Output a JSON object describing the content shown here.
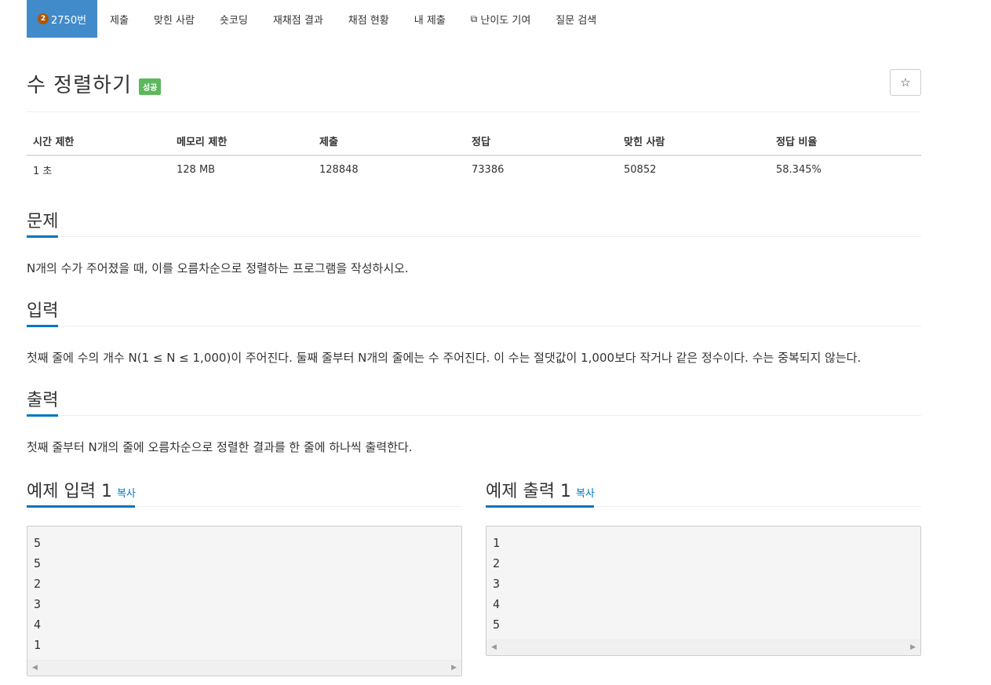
{
  "nav": {
    "problem_tier": "2",
    "problem_number": "2750번",
    "items": [
      "제출",
      "맞힌 사람",
      "숏코딩",
      "재채점 결과",
      "채점 현황",
      "내 제출"
    ],
    "difficulty": "난이도 기여",
    "qna": "질문 검색"
  },
  "title": {
    "text": "수 정렬하기",
    "badge": "성공",
    "star": "☆"
  },
  "info": {
    "headers": [
      "시간 제한",
      "메모리 제한",
      "제출",
      "정답",
      "맞힌 사람",
      "정답 비율"
    ],
    "values": [
      "1 초",
      "128 MB",
      "128848",
      "73386",
      "50852",
      "58.345%"
    ]
  },
  "problem": {
    "heading": "문제",
    "text": "N개의 수가 주어졌을 때, 이를 오름차순으로 정렬하는 프로그램을 작성하시오."
  },
  "input": {
    "heading": "입력",
    "text": "첫째 줄에 수의 개수 N(1 ≤ N ≤ 1,000)이 주어진다. 둘째 줄부터 N개의 줄에는 수 주어진다. 이 수는 절댓값이 1,000보다 작거나 같은 정수이다. 수는 중복되지 않는다."
  },
  "output": {
    "heading": "출력",
    "text": "첫째 줄부터 N개의 줄에 오름차순으로 정렬한 결과를 한 줄에 하나씩 출력한다."
  },
  "sample_input": {
    "heading": "예제 입력 1",
    "copy": "복사",
    "lines": [
      "5",
      "5",
      "2",
      "3",
      "4",
      "1"
    ]
  },
  "sample_output": {
    "heading": "예제 출력 1",
    "copy": "복사",
    "lines": [
      "1",
      "2",
      "3",
      "4",
      "5"
    ]
  }
}
